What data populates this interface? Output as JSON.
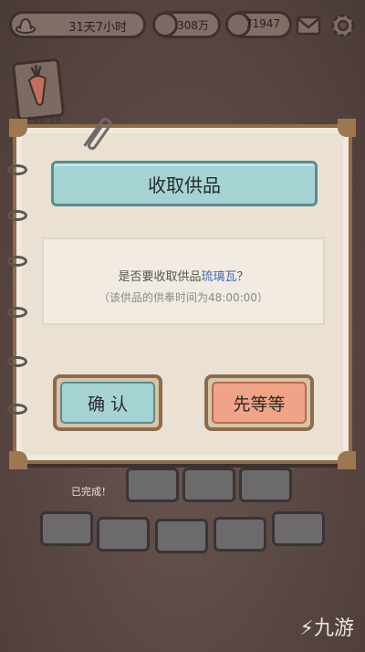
{
  "status": {
    "time_left": "31天7小时",
    "currency_1": "308万",
    "currency_2": "71947"
  },
  "badge": {
    "timer": "164:59:10"
  },
  "dialog": {
    "title": "收取供品",
    "question_prefix": "是否要收取供品",
    "item_name": "琉璃瓦",
    "question_suffix": "？",
    "note": "（该供品的供奉时间为48:00:00）",
    "confirm_label": "确  认",
    "later_label": "先等等"
  },
  "board": {
    "done_label": "已完成！"
  },
  "watermark": {
    "logo_text": "九游"
  },
  "colors": {
    "accent_teal": "#a5d3d4",
    "accent_salmon": "#f0a487",
    "frame_brown": "#8c6c4d",
    "item_blue": "#3d6bb3"
  }
}
